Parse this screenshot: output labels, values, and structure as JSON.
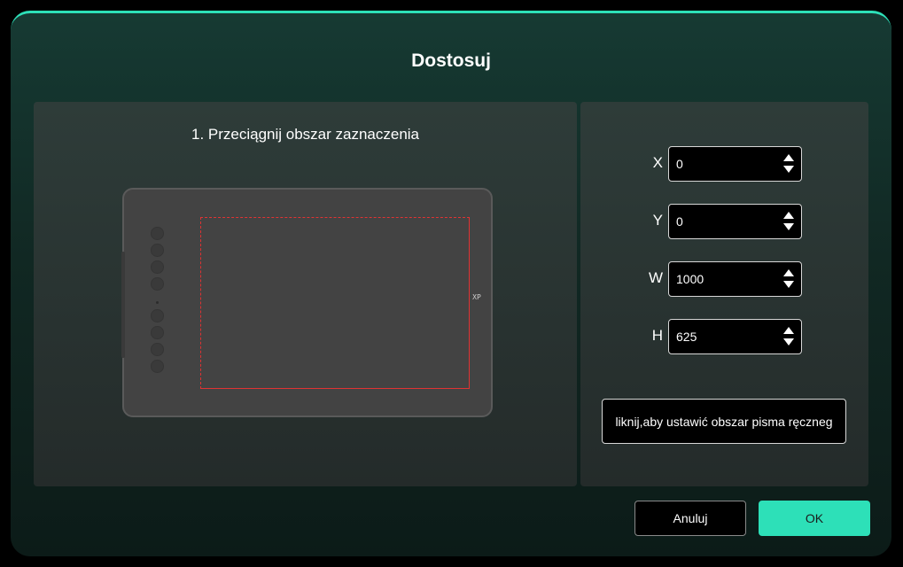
{
  "dialog": {
    "title": "Dostosuj",
    "accent_color": "#2de0b8"
  },
  "left_panel": {
    "instruction": "1. Przeciągnij obszar zaznaczenia",
    "tablet": {
      "logo_text": "XP",
      "active_area_color": "#e03333"
    }
  },
  "right_panel": {
    "fields": [
      {
        "label": "X",
        "value": "0"
      },
      {
        "label": "Y",
        "value": "0"
      },
      {
        "label": "W",
        "value": "1000"
      },
      {
        "label": "H",
        "value": "625"
      }
    ],
    "set_area_button": "liknij,aby ustawić obszar pisma ręczneg"
  },
  "footer": {
    "cancel_label": "Anuluj",
    "ok_label": "OK"
  }
}
